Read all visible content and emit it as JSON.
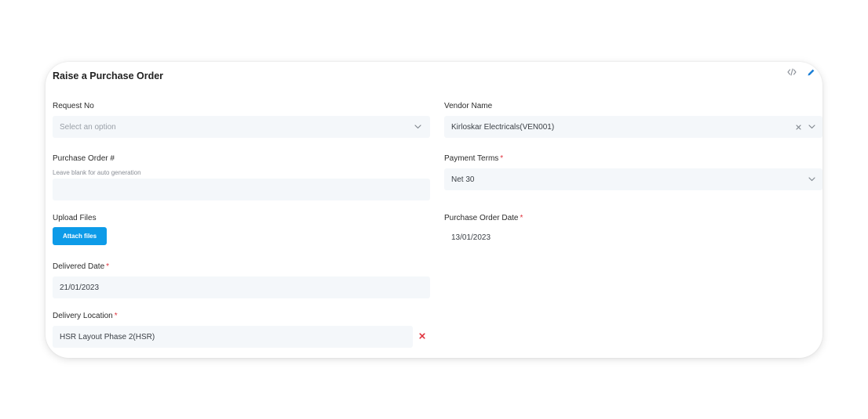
{
  "form": {
    "title": "Raise a Purchase Order",
    "request_no": {
      "label": "Request No",
      "placeholder": "Select an option"
    },
    "vendor_name": {
      "label": "Vendor Name",
      "value": "Kirloskar Electricals(VEN001)"
    },
    "purchase_order": {
      "label": "Purchase Order #",
      "hint": "Leave blank for auto generation",
      "value": ""
    },
    "payment_terms": {
      "label": "Payment Terms",
      "required": "*",
      "value": "Net 30"
    },
    "upload_files": {
      "label": "Upload Files",
      "button": "Attach files"
    },
    "purchase_order_date": {
      "label": "Purchase Order Date",
      "required": "*",
      "value": "13/01/2023"
    },
    "delivered_date": {
      "label": "Delivered Date",
      "required": "*",
      "value": "21/01/2023"
    },
    "delivery_location": {
      "label": "Delivery Location",
      "required": "*",
      "value": "HSR Layout Phase 2(HSR)"
    }
  },
  "icons": {
    "code": "code-icon",
    "edit": "pencil-icon",
    "chevron": "chevron-down-icon",
    "clear": "close-icon",
    "remove": "remove-icon"
  },
  "colors": {
    "accent": "#0d9be8",
    "required": "#e0323c",
    "field_bg": "#f4f7fa"
  }
}
